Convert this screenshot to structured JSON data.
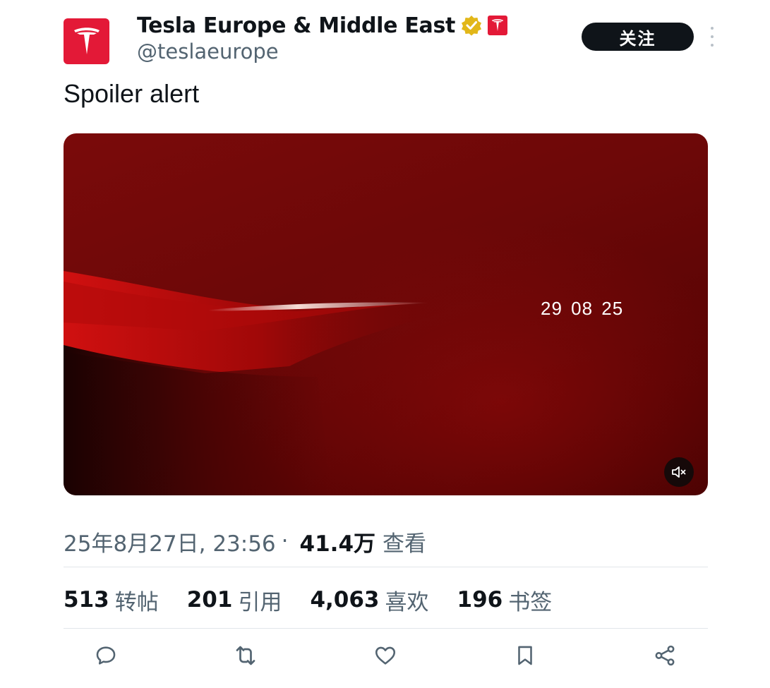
{
  "account": {
    "display_name": "Tesla Europe & Middle East",
    "handle": "@teslaeurope",
    "brand_color": "#e31937",
    "verified_badge_color": "#e2b719",
    "follow_label": "关注"
  },
  "tweet": {
    "text": "Spoiler alert",
    "media": {
      "overlay_text": "29 08 25",
      "mute_icon": "volume-mute-icon"
    }
  },
  "meta": {
    "timestamp": "25年8月27日, 23:56",
    "separator": "·",
    "views": "41.4万",
    "views_label": "查看"
  },
  "stats": [
    {
      "count": "513",
      "label": "转帖"
    },
    {
      "count": "201",
      "label": "引用"
    },
    {
      "count": "4,063",
      "label": "喜欢"
    },
    {
      "count": "196",
      "label": "书签"
    }
  ],
  "actions": [
    {
      "icon": "reply-icon"
    },
    {
      "icon": "retweet-icon"
    },
    {
      "icon": "like-icon"
    },
    {
      "icon": "bookmark-icon"
    },
    {
      "icon": "share-icon"
    }
  ]
}
